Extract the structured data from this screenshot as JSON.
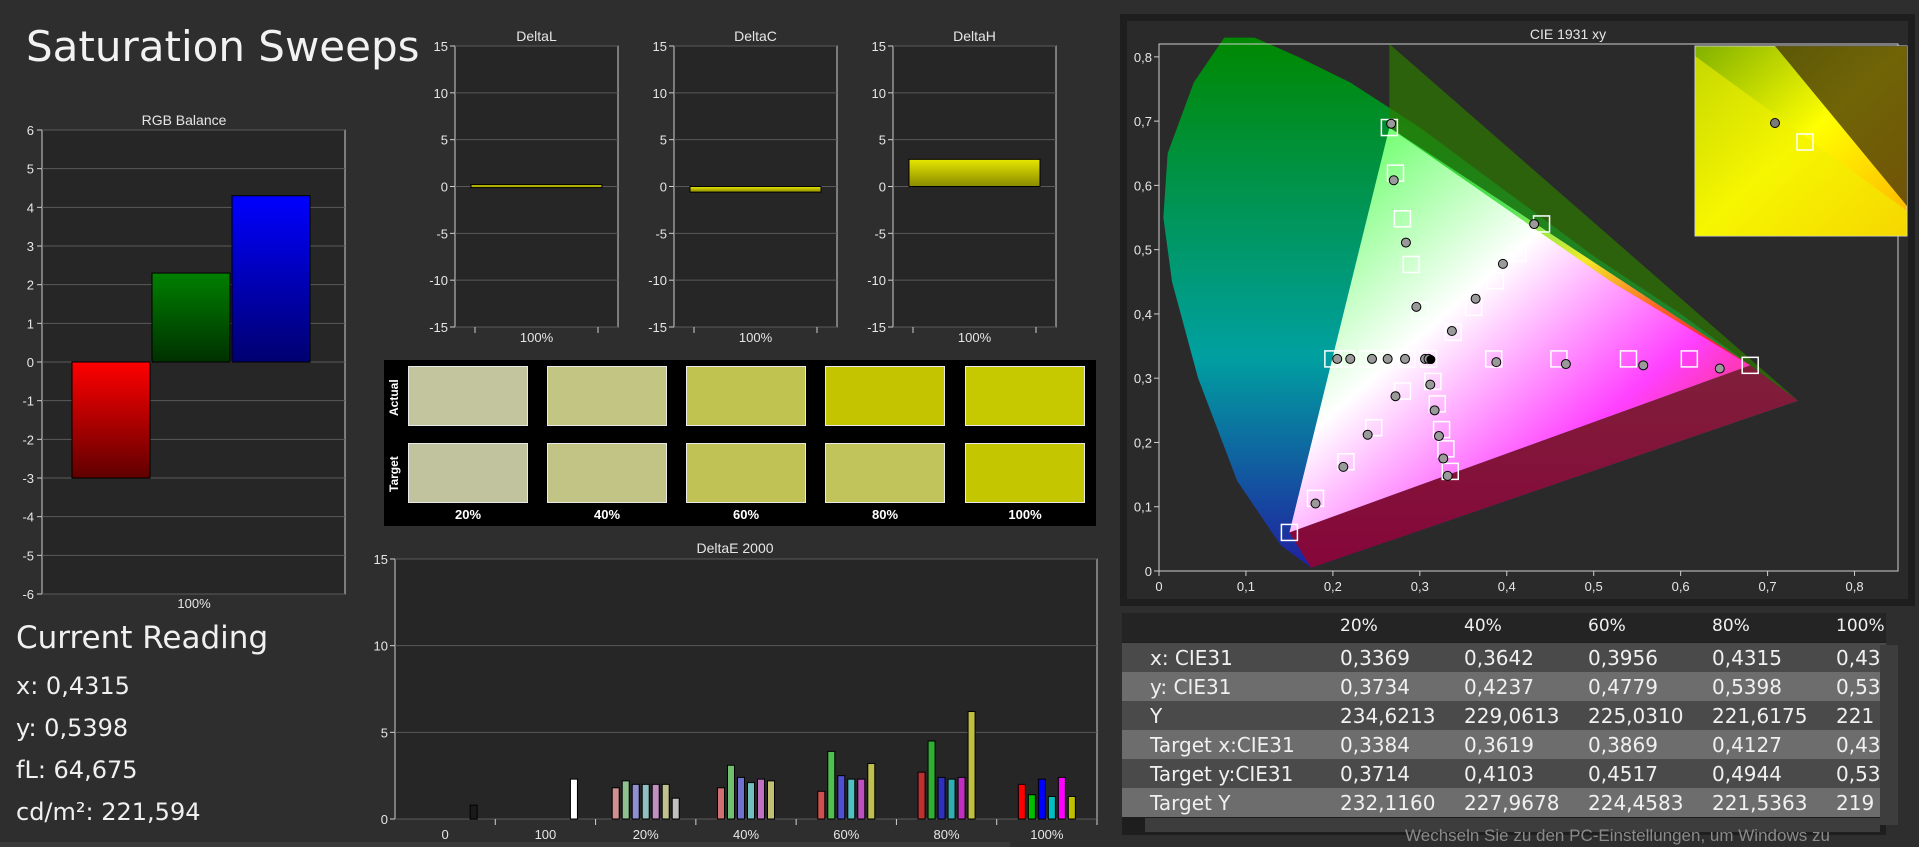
{
  "page": {
    "title": "Saturation Sweeps"
  },
  "rgb_balance": {
    "title": "RGB Balance",
    "y_ticks": [
      "6",
      "5",
      "4",
      "3",
      "2",
      "1",
      "0",
      "-1",
      "-2",
      "-3",
      "-4",
      "-5",
      "-6"
    ],
    "x_label": "100%",
    "chart_data": {
      "type": "bar",
      "categories": [
        "Red",
        "Green",
        "Blue"
      ],
      "values": [
        -3.0,
        2.3,
        4.3
      ],
      "ylim": [
        -6,
        6
      ],
      "colors": [
        "#ff0000",
        "#008000",
        "#0000ff"
      ]
    }
  },
  "delta_panels": [
    {
      "title": "DeltaL",
      "x_label": "100%",
      "value": 0.2,
      "ylim": [
        -15,
        15
      ],
      "y_ticks": [
        "15",
        "10",
        "5",
        "0",
        "-5",
        "-10",
        "-15"
      ]
    },
    {
      "title": "DeltaC",
      "x_label": "100%",
      "value": -0.6,
      "ylim": [
        -15,
        15
      ],
      "y_ticks": [
        "15",
        "10",
        "5",
        "0",
        "-5",
        "-10",
        "-15"
      ]
    },
    {
      "title": "DeltaH",
      "x_label": "100%",
      "value": 2.9,
      "ylim": [
        -15,
        15
      ],
      "y_ticks": [
        "15",
        "10",
        "5",
        "0",
        "-5",
        "-10",
        "-15"
      ]
    }
  ],
  "swatches": {
    "actual_label": "Actual",
    "target_label": "Target",
    "labels": [
      "20%",
      "40%",
      "60%",
      "80%",
      "100%"
    ],
    "actual_colors": [
      "#c2c59d",
      "#c3c682",
      "#c0c350",
      "#c4c500",
      "#c6c800"
    ],
    "target_colors": [
      "#c1c39f",
      "#c1c484",
      "#c0c255",
      "#c1c35b",
      "#c4c600"
    ]
  },
  "deltae": {
    "title": "DeltaE 2000",
    "y_ticks": [
      "15",
      "10",
      "5",
      "0"
    ],
    "x_labels": [
      "0",
      "100",
      "20%",
      "40%",
      "60%",
      "80%",
      "100%"
    ],
    "chart_data": {
      "type": "bar",
      "ylim": [
        0,
        15
      ],
      "groups": [
        {
          "label": "0",
          "values": [
            0.8
          ],
          "colors": [
            "#1a1a1a"
          ]
        },
        {
          "label": "100",
          "values": [
            2.3
          ],
          "colors": [
            "#ffffff"
          ]
        },
        {
          "label": "20%",
          "values": [
            1.8,
            2.2,
            2.0,
            2.0,
            2.0,
            2.0,
            1.2
          ],
          "colors": [
            "#d09090",
            "#90c090",
            "#9090d0",
            "#90c0c0",
            "#c090c0",
            "#c0c090",
            "#c0c0c0"
          ]
        },
        {
          "label": "40%",
          "values": [
            1.8,
            3.1,
            2.4,
            2.1,
            2.3,
            2.2
          ],
          "colors": [
            "#d07070",
            "#70c070",
            "#7070d0",
            "#70c0c0",
            "#c070c0",
            "#c0c070"
          ]
        },
        {
          "label": "60%",
          "values": [
            1.6,
            3.9,
            2.5,
            2.3,
            2.3,
            3.2
          ],
          "colors": [
            "#d05050",
            "#50c050",
            "#5050d0",
            "#50c0c0",
            "#c050c0",
            "#c0c050"
          ]
        },
        {
          "label": "80%",
          "values": [
            2.7,
            4.5,
            2.4,
            2.3,
            2.4,
            6.2
          ],
          "colors": [
            "#c03030",
            "#30b030",
            "#3030c0",
            "#30b0b0",
            "#c030c0",
            "#c0c040"
          ]
        },
        {
          "label": "100%",
          "values": [
            2.0,
            1.4,
            2.3,
            1.3,
            2.4,
            1.3
          ],
          "colors": [
            "#ff0000",
            "#00c000",
            "#0000ff",
            "#00c0c0",
            "#ff00ff",
            "#c0c000"
          ]
        }
      ]
    }
  },
  "reading": {
    "heading": "Current Reading",
    "x": "x: 0,4315",
    "y": "y: 0,5398",
    "fl": "fL: 64,675",
    "cd": "cd/m²: 221,594"
  },
  "cie": {
    "title": "CIE 1931 xy",
    "x_ticks": [
      "0",
      "0,1",
      "0,2",
      "0,3",
      "0,4",
      "0,5",
      "0,6",
      "0,7",
      "0,8"
    ],
    "y_ticks": [
      "0,8",
      "0,7",
      "0,6",
      "0,5",
      "0,4",
      "0,3",
      "0,2",
      "0,1",
      "0"
    ],
    "chart_data": {
      "type": "scatter",
      "gamut": [
        [
          0.68,
          0.32
        ],
        [
          0.265,
          0.69
        ],
        [
          0.15,
          0.06
        ]
      ],
      "white": [
        0.3127,
        0.329
      ],
      "targets": [
        [
          0.265,
          0.69
        ],
        [
          0.272,
          0.619
        ],
        [
          0.28,
          0.548
        ],
        [
          0.29,
          0.477
        ],
        [
          0.3,
          0.405
        ],
        [
          0.2,
          0.33
        ],
        [
          0.215,
          0.33
        ],
        [
          0.24,
          0.33
        ],
        [
          0.26,
          0.33
        ],
        [
          0.285,
          0.33
        ],
        [
          0.31,
          0.33
        ],
        [
          0.385,
          0.33
        ],
        [
          0.46,
          0.33
        ],
        [
          0.54,
          0.33
        ],
        [
          0.61,
          0.33
        ],
        [
          0.68,
          0.32
        ],
        [
          0.15,
          0.06
        ],
        [
          0.18,
          0.113
        ],
        [
          0.215,
          0.17
        ],
        [
          0.247,
          0.223
        ],
        [
          0.28,
          0.28
        ],
        [
          0.3384,
          0.3714
        ],
        [
          0.3619,
          0.4103
        ],
        [
          0.3869,
          0.4517
        ],
        [
          0.4127,
          0.4944
        ],
        [
          0.44,
          0.54
        ],
        [
          0.315,
          0.295
        ],
        [
          0.32,
          0.26
        ],
        [
          0.325,
          0.22
        ],
        [
          0.33,
          0.19
        ],
        [
          0.335,
          0.155
        ]
      ],
      "actuals": [
        [
          0.267,
          0.696
        ],
        [
          0.27,
          0.608
        ],
        [
          0.284,
          0.511
        ],
        [
          0.296,
          0.411
        ],
        [
          0.205,
          0.33
        ],
        [
          0.22,
          0.33
        ],
        [
          0.245,
          0.33
        ],
        [
          0.263,
          0.33
        ],
        [
          0.283,
          0.33
        ],
        [
          0.306,
          0.33
        ],
        [
          0.388,
          0.325
        ],
        [
          0.468,
          0.322
        ],
        [
          0.557,
          0.32
        ],
        [
          0.645,
          0.315
        ],
        [
          0.18,
          0.105
        ],
        [
          0.212,
          0.162
        ],
        [
          0.24,
          0.212
        ],
        [
          0.272,
          0.272
        ],
        [
          0.3369,
          0.3734
        ],
        [
          0.3642,
          0.4237
        ],
        [
          0.3956,
          0.4779
        ],
        [
          0.4315,
          0.5398
        ],
        [
          0.312,
          0.29
        ],
        [
          0.317,
          0.25
        ],
        [
          0.322,
          0.21
        ],
        [
          0.327,
          0.175
        ],
        [
          0.332,
          0.148
        ],
        [
          0.31,
          0.33
        ]
      ],
      "inset": {
        "target": [
          0.44,
          0.54
        ],
        "actual": [
          0.4315,
          0.5398
        ]
      }
    }
  },
  "table": {
    "headers": [
      "",
      "20%",
      "40%",
      "60%",
      "80%",
      "100%"
    ],
    "rows": [
      {
        "label": "x: CIE31",
        "values": [
          "0,3369",
          "0,3642",
          "0,3956",
          "0,4315",
          "0,43"
        ]
      },
      {
        "label": "y: CIE31",
        "values": [
          "0,3734",
          "0,4237",
          "0,4779",
          "0,5398",
          "0,53"
        ]
      },
      {
        "label": "Y",
        "values": [
          "234,6213",
          "229,0613",
          "225,0310",
          "221,6175",
          "221"
        ]
      },
      {
        "label": "Target x:CIE31",
        "values": [
          "0,3384",
          "0,3619",
          "0,3869",
          "0,4127",
          "0,43"
        ]
      },
      {
        "label": "Target y:CIE31",
        "values": [
          "0,3714",
          "0,4103",
          "0,4517",
          "0,4944",
          "0,53"
        ]
      },
      {
        "label": "Target Y",
        "values": [
          "232,1160",
          "227,9678",
          "224,4583",
          "221,5363",
          "219"
        ]
      }
    ]
  },
  "watermark": "Wechseln Sie zu den PC-Einstellungen, um Windows zu"
}
